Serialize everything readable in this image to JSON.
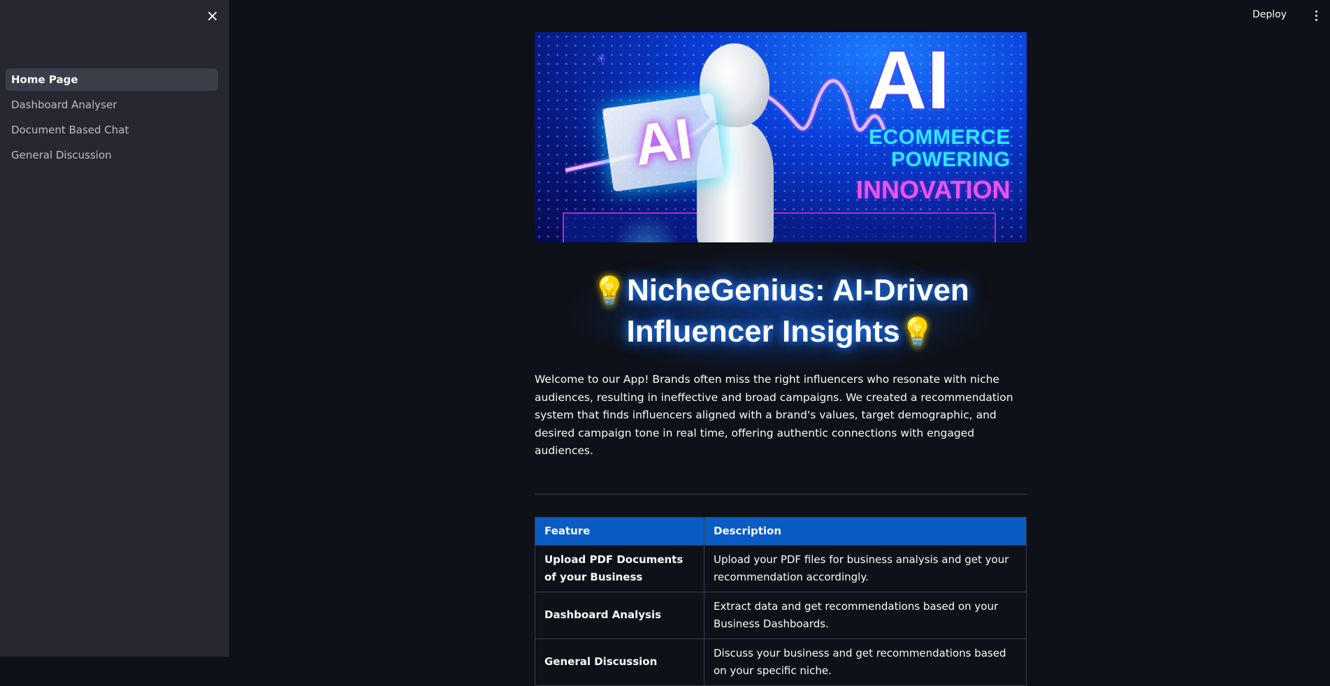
{
  "sidebar": {
    "close_icon": "×",
    "items": [
      {
        "label": "Home Page",
        "active": true
      },
      {
        "label": "Dashboard Analyser",
        "active": false
      },
      {
        "label": "Document Based Chat",
        "active": false
      },
      {
        "label": "General Discussion",
        "active": false
      }
    ]
  },
  "toolbar": {
    "deploy_label": "Deploy",
    "menu_icon": "kebab-menu-icon"
  },
  "hero": {
    "big_text": "AI",
    "card_text": "AI",
    "line1": "ECOMMERCE",
    "line2": "POWERING",
    "line3": "INNOVATION"
  },
  "title": {
    "bulb": "💡",
    "line1": "NicheGenius: AI-Driven",
    "line2": "Influencer Insights"
  },
  "intro": "Welcome to our App! Brands often miss the right influencers who resonate with niche audiences, resulting in ineffective and broad campaigns. We created a recommendation system that finds influencers aligned with a brand's values, target demographic, and desired campaign tone in real time, offering authentic connections with engaged audiences.",
  "table": {
    "headers": [
      "Feature",
      "Description"
    ],
    "rows": [
      {
        "feature": "Upload PDF Documents of your Business",
        "description": "Upload your PDF files for business analysis and get your recommendation accordingly."
      },
      {
        "feature": "Dashboard Analysis",
        "description": "Extract data and get recommendations based on your Business Dashboards."
      },
      {
        "feature": "General Discussion",
        "description": "Discuss your business and get recommendations based on your specific niche."
      }
    ]
  },
  "colors": {
    "background": "#0e1117",
    "sidebar": "#262730",
    "table_header": "#0a5bc4",
    "title_glow": "#1f7bff"
  }
}
